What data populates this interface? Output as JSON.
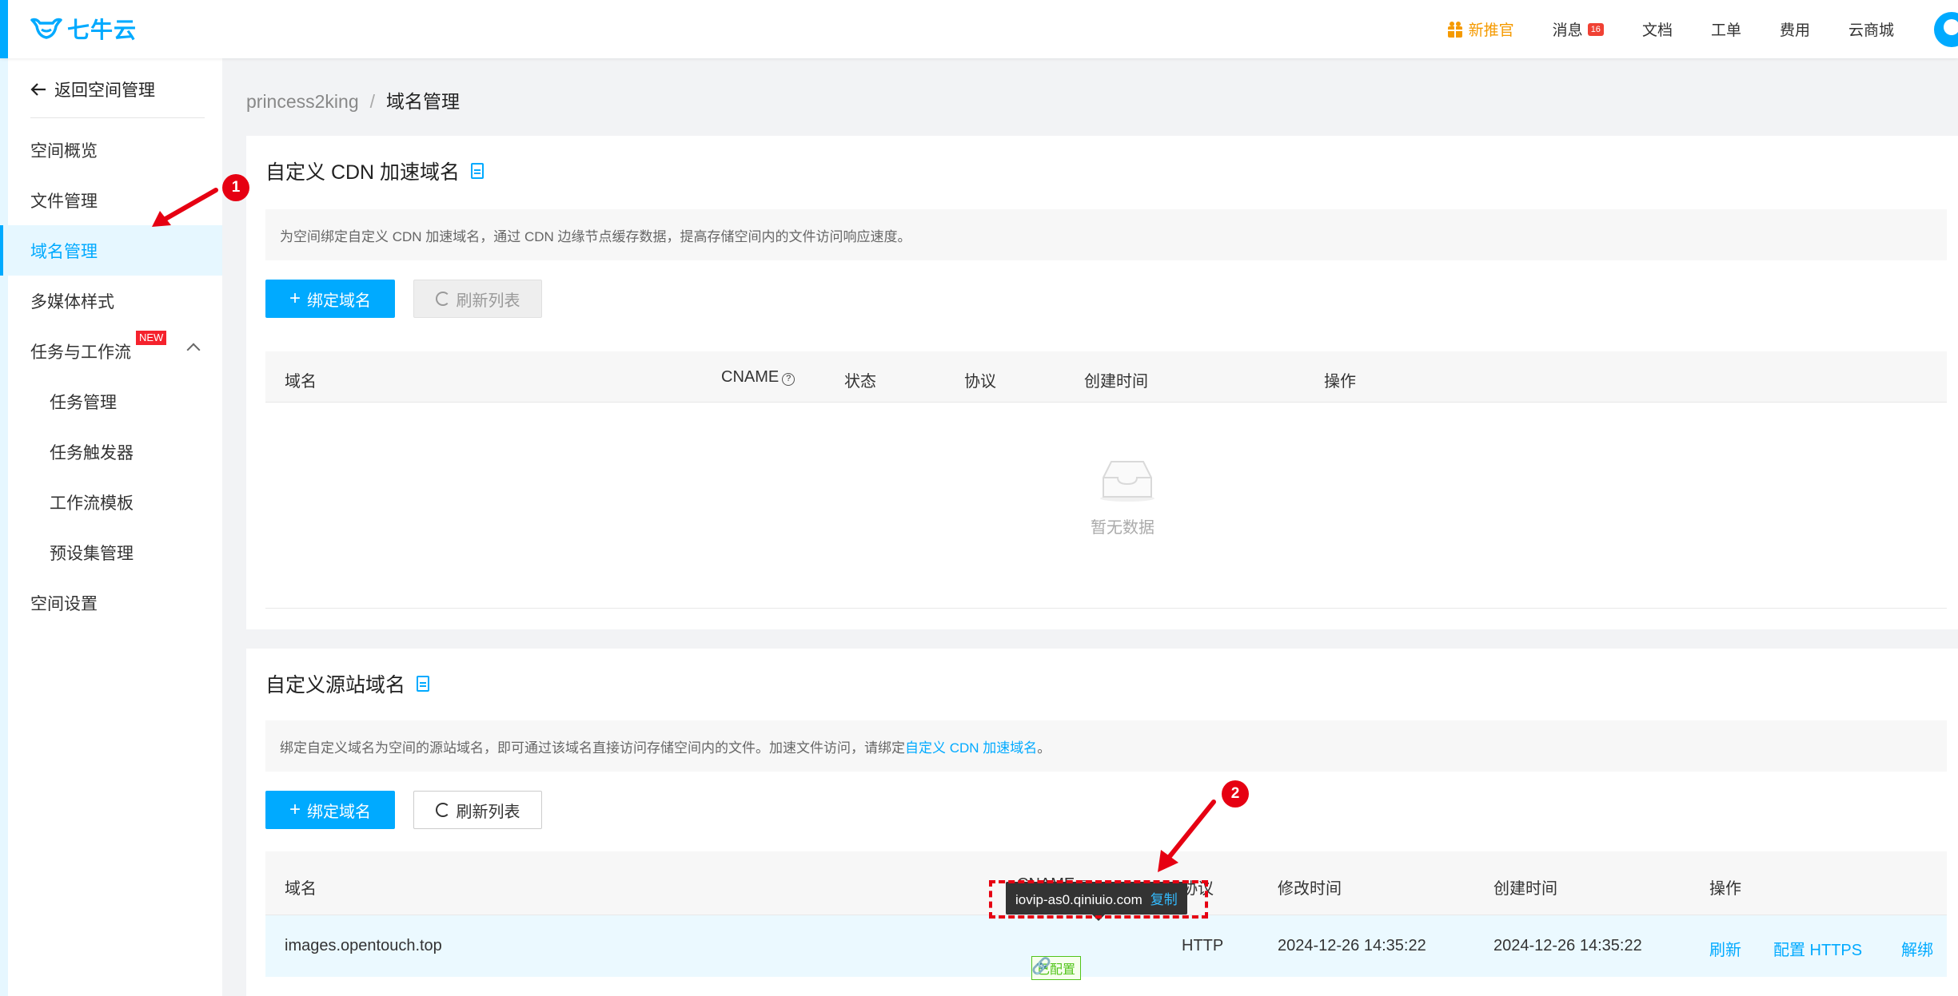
{
  "topbar": {
    "logo_text": "七牛云",
    "nav": {
      "promo": "新推官",
      "messages": "消息",
      "messages_count": "16",
      "docs": "文档",
      "tickets": "工单",
      "billing": "费用",
      "market": "云商城"
    }
  },
  "sidebar": {
    "back_label": "返回空间管理",
    "items": [
      {
        "label": "空间概览"
      },
      {
        "label": "文件管理"
      },
      {
        "label": "域名管理",
        "active": true
      },
      {
        "label": "多媒体样式"
      },
      {
        "label": "任务与工作流",
        "tag": "NEW"
      },
      {
        "label": "任务管理"
      },
      {
        "label": "任务触发器"
      },
      {
        "label": "工作流模板"
      },
      {
        "label": "预设集管理"
      },
      {
        "label": "空间设置"
      }
    ]
  },
  "breadcrumb": {
    "bucket": "princess2king",
    "separator": "/",
    "current": "域名管理"
  },
  "cdn_section": {
    "title": "自定义 CDN 加速域名",
    "description": "为空间绑定自定义 CDN 加速域名，通过 CDN 边缘节点缓存数据，提高存储空间内的文件访问响应速度。",
    "bind_button": "绑定域名",
    "refresh_button": "刷新列表",
    "columns": [
      "域名",
      "CNAME",
      "状态",
      "协议",
      "创建时间",
      "操作"
    ],
    "empty_text": "暂无数据"
  },
  "origin_section": {
    "title": "自定义源站域名",
    "description_prefix": "绑定自定义域名为空间的源站域名，即可通过该域名直接访问存储空间内的文件。加速文件访问，请绑定",
    "description_link": "自定义 CDN 加速域名",
    "description_suffix": "。",
    "bind_button": "绑定域名",
    "refresh_button": "刷新列表",
    "columns": [
      "域名",
      "CNAME",
      "协议",
      "修改时间",
      "创建时间",
      "操作"
    ],
    "rows": [
      {
        "domain": "images.opentouch.top",
        "cname_status": "已配置",
        "protocol": "HTTP",
        "modified": "2024-12-26 14:35:22",
        "created": "2024-12-26 14:35:22",
        "actions": [
          "刷新",
          "配置 HTTPS",
          "解绑"
        ]
      }
    ]
  },
  "tooltip": {
    "cname_value": "iovip-as0.qiniuio.com",
    "copy_label": "复制"
  },
  "annotations": {
    "marker_1": "1",
    "marker_2": "2",
    "color": "#e60012"
  },
  "colors": {
    "accent": "#00aaff",
    "success": "#52c41a",
    "promo": "#f59a00",
    "danger": "#f5222d"
  }
}
